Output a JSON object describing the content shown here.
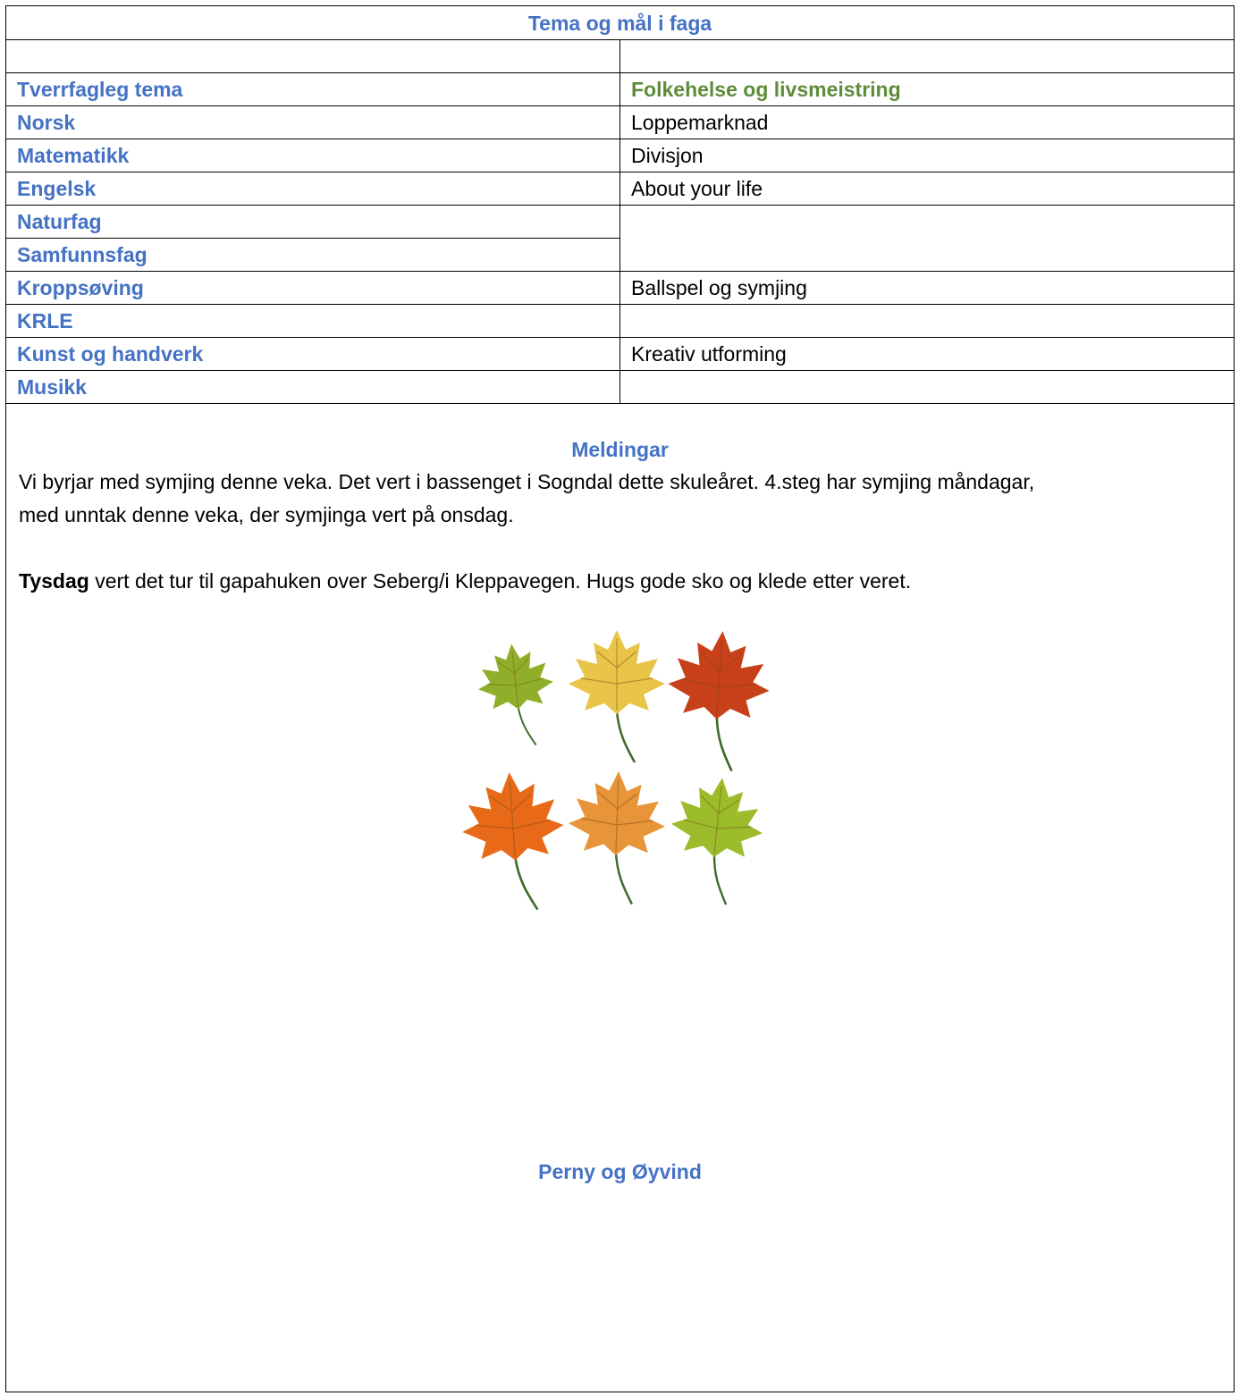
{
  "table": {
    "title": "Tema og mål i faga",
    "theme_label": "Tverrfagleg tema",
    "theme_value": "Folkehelse og livsmeistring",
    "rows": [
      {
        "subject": "Norsk",
        "goal": "Loppemarknad"
      },
      {
        "subject": "Matematikk",
        "goal": "Divisjon"
      },
      {
        "subject": "Engelsk",
        "goal": "About your life"
      },
      {
        "subject": "Naturfag",
        "goal": ""
      },
      {
        "subject": "Samfunnsfag",
        "goal": ""
      },
      {
        "subject": "Kroppsøving",
        "goal": "Ballspel og symjing"
      },
      {
        "subject": "KRLE",
        "goal": ""
      },
      {
        "subject": "Kunst og handverk",
        "goal": "Kreativ utforming"
      },
      {
        "subject": "Musikk",
        "goal": ""
      }
    ]
  },
  "messages": {
    "heading": "Meldingar",
    "paragraph1_line1": "Vi byrjar med symjing denne veka. Det vert i bassenget i Sogndal dette skuleåret. 4.steg har symjing måndagar,",
    "paragraph1_line2": "med unntak denne veka, der symjinga vert på onsdag.",
    "paragraph2_bold": "Tysdag",
    "paragraph2_rest": " vert det tur til gapahuken over Seberg/i Kleppavegen. Hugs gode sko og klede etter veret."
  },
  "illustration": {
    "icon": "autumn-leaves-icon",
    "leaf_colors": [
      "#8fae2a",
      "#e8c448",
      "#c8401a",
      "#e86a18",
      "#e89438",
      "#9cbc2c"
    ]
  },
  "signature": "Perny og Øyvind"
}
